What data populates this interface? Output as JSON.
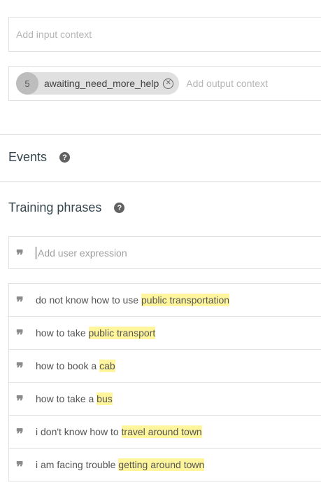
{
  "contexts": {
    "input_placeholder": "Add input context",
    "output_chip": {
      "count": "5",
      "label": "awaiting_need_more_help"
    },
    "output_placeholder": "Add output context"
  },
  "events": {
    "title": "Events"
  },
  "training": {
    "title": "Training phrases",
    "input_placeholder": "Add user expression",
    "phrases": [
      {
        "before": "do not know how to use ",
        "highlight": "public transportation"
      },
      {
        "before": "how to take ",
        "highlight": "public transport"
      },
      {
        "before": "how to book a ",
        "highlight": "cab"
      },
      {
        "before": "how to take a ",
        "highlight": "bus"
      },
      {
        "before": "i don't know how to ",
        "highlight": "travel around town"
      },
      {
        "before": "i am facing trouble ",
        "highlight": "getting around town"
      }
    ]
  },
  "colors": {
    "highlight": "#fff59d",
    "chip": "#e0e0e0",
    "chip_count": "#bdbdbd"
  }
}
